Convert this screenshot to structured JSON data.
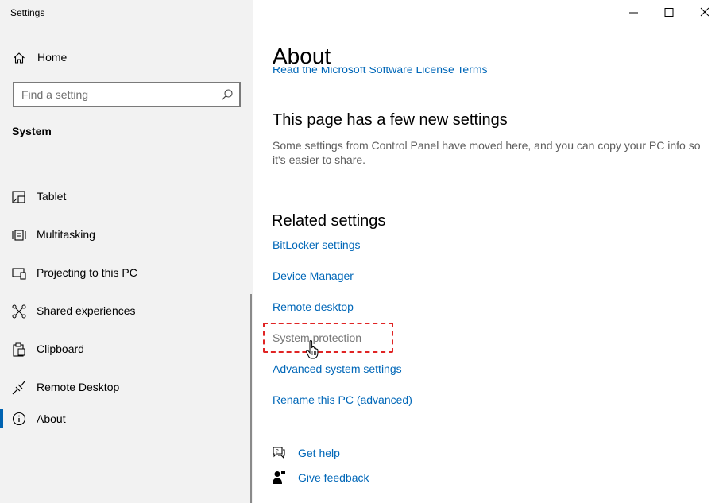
{
  "app": {
    "title": "Settings"
  },
  "sidebar": {
    "home_label": "Home",
    "search_placeholder": "Find a setting",
    "section_title": "System",
    "items": [
      {
        "label": "Tablet",
        "icon": "tablet-icon"
      },
      {
        "label": "Multitasking",
        "icon": "multitasking-icon"
      },
      {
        "label": "Projecting to this PC",
        "icon": "projecting-icon"
      },
      {
        "label": "Shared experiences",
        "icon": "shared-experiences-icon"
      },
      {
        "label": "Clipboard",
        "icon": "clipboard-icon"
      },
      {
        "label": "Remote Desktop",
        "icon": "remote-desktop-icon"
      },
      {
        "label": "About",
        "icon": "info-icon",
        "selected": true
      }
    ]
  },
  "main": {
    "title": "About",
    "partial_link": "Read the Microsoft Software License Terms",
    "new_settings": {
      "heading": "This page has a few new settings",
      "description": "Some settings from Control Panel have moved here, and you can copy your PC info so it's easier to share."
    },
    "related": {
      "heading": "Related settings",
      "links": [
        "BitLocker settings",
        "Device Manager",
        "Remote desktop",
        "System protection",
        "Advanced system settings",
        "Rename this PC (advanced)"
      ]
    },
    "help": {
      "get_help": "Get help",
      "give_feedback": "Give feedback"
    }
  },
  "colors": {
    "accent": "#0067b8",
    "highlight": "#e02424",
    "sidebar_bg": "#f2f2f2"
  }
}
